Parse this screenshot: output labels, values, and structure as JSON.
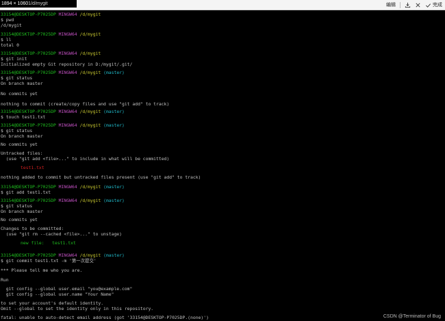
{
  "window": {
    "dims": "1894 × 1060",
    "title": "1/d/mygit"
  },
  "toolbar": {
    "edit": "编辑",
    "done": "完成"
  },
  "prompt": {
    "user": "33154@DESKTOP-P7025DP",
    "shell": "MINGW64",
    "path": "/d/mygit",
    "branch": "(master)"
  },
  "commands": {
    "pwd": "$ pwd",
    "ll": "$ ll",
    "init": "$ git init",
    "status": "$ git status",
    "touch": "$ touch test1.txt",
    "add": "$ git add test1.txt",
    "commit": "$ git commit test1.txt -m '第一次提交'"
  },
  "output": {
    "pwd_out": "/d/mygit",
    "total": "total 0",
    "init_out": "Initialized empty Git repository in D:/mygit/.git/",
    "on_branch": "On branch master",
    "no_commits": "No commits yet",
    "nothing_commit": "nothing to commit (create/copy files and use \"git add\" to track)",
    "untracked": "Untracked files:",
    "untracked_hint": "  (use \"git add <file>...\" to include in what will be committed)",
    "file": "test1.txt",
    "nothing_added": "nothing added to commit but untracked files present (use \"git add\" to track)",
    "to_be_committed": "Changes to be committed:",
    "rm_hint": "  (use \"git rm --cached <file>...\" to unstage)",
    "new_file": "new file:   test1.txt",
    "tell_me": "*** Please tell me who you are.",
    "run": "Run",
    "cfg_email": "  git config --global user.email \"you@example.com\"",
    "cfg_name": "  git config --global user.name \"Your Name\"",
    "set_identity": "to set your account's default identity.",
    "omit_global": "Omit --global to set the identity only in this repository.",
    "fatal": "fatal: unable to auto-detect email address (got '33154@DESKTOP-P7025DP.(none)')"
  },
  "watermark": "CSDN @Terminator of Bug",
  "colors": {
    "green": "#1fbd1f",
    "magenta": "#c050c0",
    "yellow": "#c8c830",
    "cyan": "#20b8c8",
    "red": "#d02020",
    "text": "#c0c0c0"
  }
}
